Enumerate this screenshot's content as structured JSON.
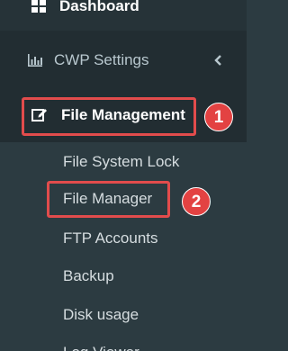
{
  "sidebar": {
    "dashboard": {
      "label": "Dashboard",
      "icon": "dashboard-grid-icon"
    },
    "cwp_settings": {
      "label": "CWP Settings",
      "icon": "bar-chart-icon",
      "chevron": "chevron-left-icon"
    },
    "file_management": {
      "label": "File Management",
      "icon": "edit-square-icon"
    },
    "submenu": [
      {
        "label": "File System Lock"
      },
      {
        "label": "File Manager"
      },
      {
        "label": "FTP Accounts"
      },
      {
        "label": "Backup"
      },
      {
        "label": "Disk usage"
      },
      {
        "label": "Log Viewer"
      }
    ]
  },
  "annotations": {
    "badge_1": "1",
    "badge_2": "2"
  },
  "colors": {
    "sidebar_bg": "#2c3b41",
    "active_bg": "#222d32",
    "accent": "#19c0a0",
    "highlight_red": "#e24c4c"
  }
}
